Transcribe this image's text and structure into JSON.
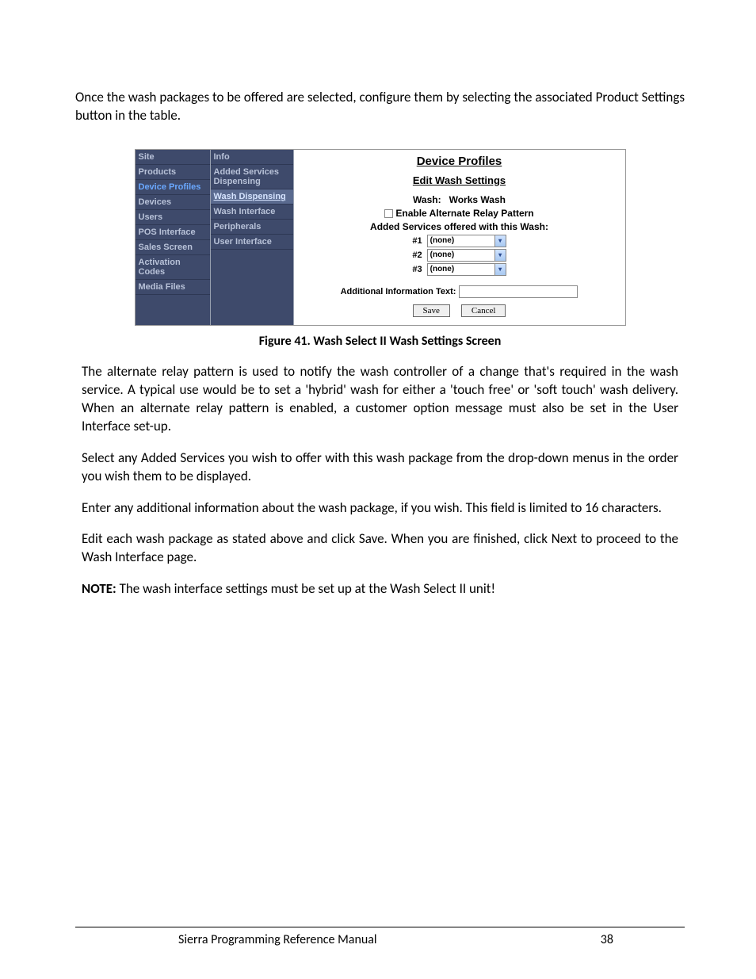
{
  "intro": "Once the wash packages to be offered are selected, configure them by selecting the associated Product Settings button in the table.",
  "screenshot": {
    "nav": [
      {
        "label": "Site",
        "active": false
      },
      {
        "label": "Products",
        "active": false
      },
      {
        "label": "Device Profiles",
        "active": true
      },
      {
        "label": "Devices",
        "active": false
      },
      {
        "label": "Users",
        "active": false
      },
      {
        "label": "POS Interface",
        "active": false
      },
      {
        "label": "Sales Screen",
        "active": false
      },
      {
        "label": "Activation Codes",
        "active": false
      },
      {
        "label": "Media Files",
        "active": false
      }
    ],
    "subnav": [
      {
        "label": "Info",
        "highlight": false
      },
      {
        "label": "Added Services Dispensing",
        "highlight": false
      },
      {
        "label": "Wash Dispensing",
        "highlight": true
      },
      {
        "label": "Wash Interface",
        "highlight": false
      },
      {
        "label": "Peripherals",
        "highlight": false
      },
      {
        "label": "User Interface",
        "highlight": false
      }
    ],
    "panel_title": "Device Profiles",
    "panel_subtitle": "Edit Wash Settings",
    "wash_label": "Wash:",
    "wash_value": "Works Wash",
    "enable_alt": "Enable Alternate Relay Pattern",
    "services_header": "Added Services offered with this Wash:",
    "services": [
      {
        "num": "#1",
        "value": "(none)"
      },
      {
        "num": "#2",
        "value": "(none)"
      },
      {
        "num": "#3",
        "value": "(none)"
      }
    ],
    "additional_label": "Additional Information Text:",
    "additional_value": "",
    "save": "Save",
    "cancel": "Cancel"
  },
  "caption": "Figure 41. Wash Select II Wash Settings Screen",
  "para1": "The alternate relay pattern is used to notify the wash controller of a change that's required in the wash service. A typical use would be to set a 'hybrid' wash for either a 'touch free' or 'soft touch' wash delivery. When an alternate relay pattern is enabled, a customer option message must also be set in the User Interface set-up.",
  "para2": "Select any Added Services you wish to offer with this wash package from the drop-down menus in the order you wish them to be displayed.",
  "para3": "Enter any additional information about the wash package, if you wish. This field is limited to 16 characters.",
  "para4": "Edit each wash package as stated above and click Save. When you are finished, click Next to proceed to the Wash Interface page.",
  "note_label": "NOTE:",
  "note_text": " The wash interface settings must be set up at the Wash Select II unit!",
  "footer_title": "Sierra Programming Reference Manual",
  "footer_page": "38"
}
